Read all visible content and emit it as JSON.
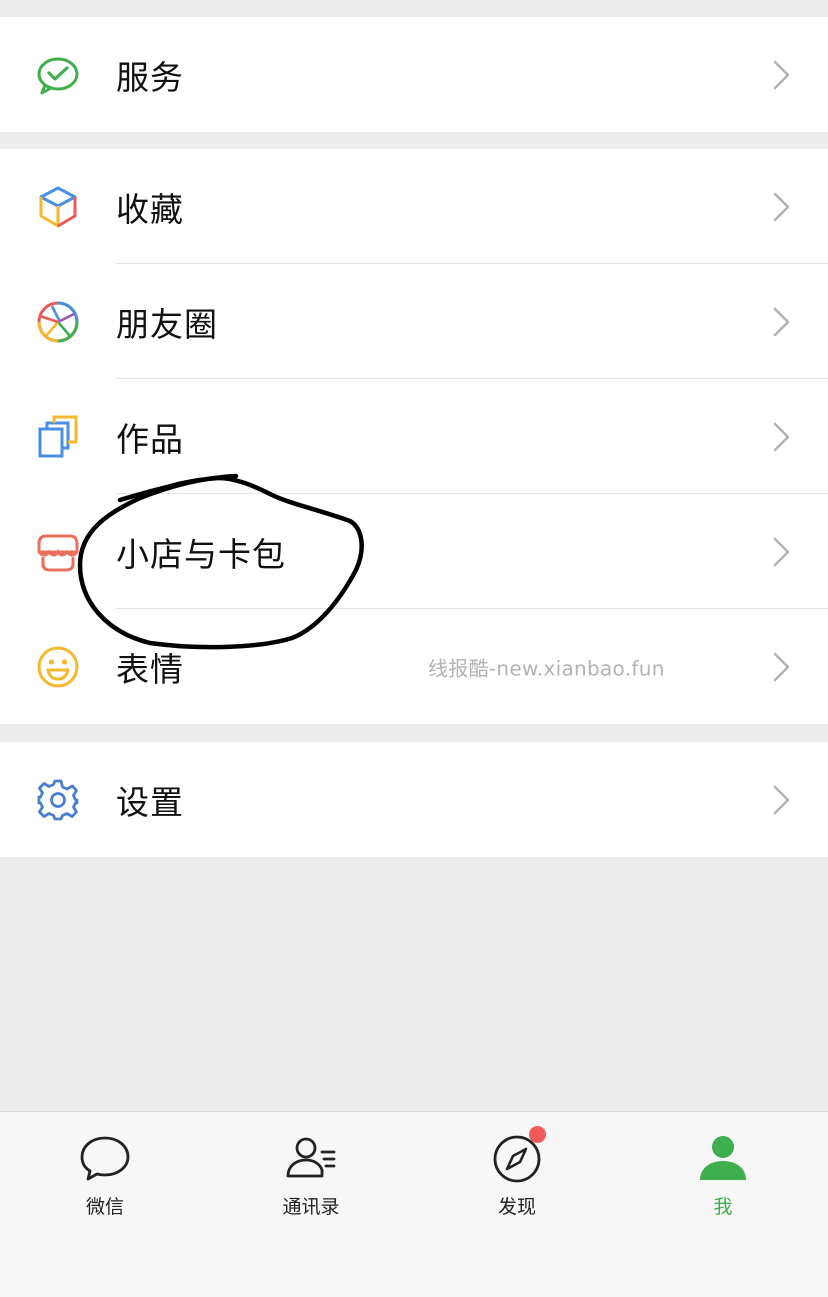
{
  "groups": {
    "services": {
      "items": [
        {
          "label": "服务",
          "icon": "wechat-pay-check-icon"
        }
      ]
    },
    "main": {
      "items": [
        {
          "label": "收藏",
          "icon": "favorites-cube-icon"
        },
        {
          "label": "朋友圈",
          "icon": "moments-aperture-icon"
        },
        {
          "label": "作品",
          "icon": "works-stack-icon"
        },
        {
          "label": "小店与卡包",
          "icon": "shop-awning-icon"
        },
        {
          "label": "表情",
          "icon": "smiley-face-icon"
        }
      ]
    },
    "settings": {
      "items": [
        {
          "label": "设置",
          "icon": "gear-icon"
        }
      ]
    }
  },
  "watermark": "线报酷-new.xianbao.fun",
  "tabbar": {
    "tabs": [
      {
        "label": "微信",
        "icon": "chat-bubble-icon",
        "active": false
      },
      {
        "label": "通讯录",
        "icon": "contacts-icon",
        "active": false
      },
      {
        "label": "发现",
        "icon": "compass-icon",
        "active": false,
        "badge": true
      },
      {
        "label": "我",
        "icon": "person-icon",
        "active": true
      }
    ]
  },
  "colors": {
    "accent_green": "#3fae4d",
    "badge_red": "#f15a5a",
    "background": "#ededed",
    "annotation_ink": "#000000"
  }
}
